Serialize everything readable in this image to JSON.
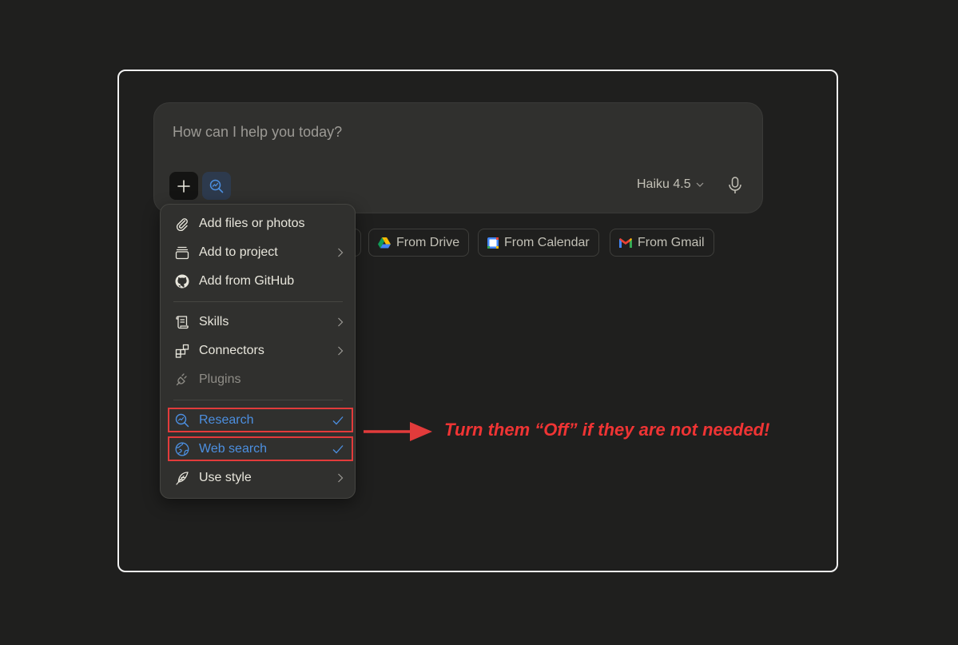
{
  "composer": {
    "placeholder": "How can I help you today?",
    "model": "Haiku 4.5"
  },
  "chips": [
    {
      "label": "From Drive",
      "icon": "google-drive-icon"
    },
    {
      "label": "From Calendar",
      "icon": "google-calendar-icon"
    },
    {
      "label": "From Gmail",
      "icon": "gmail-icon"
    }
  ],
  "menu": {
    "items": [
      {
        "label": "Add files or photos",
        "icon": "paperclip-icon",
        "submenu": false
      },
      {
        "label": "Add to project",
        "icon": "archive-box-icon",
        "submenu": true
      },
      {
        "label": "Add from GitHub",
        "icon": "github-icon",
        "submenu": false
      },
      {
        "label": "Skills",
        "icon": "scroll-icon",
        "submenu": true
      },
      {
        "label": "Connectors",
        "icon": "blocks-icon",
        "submenu": true
      },
      {
        "label": "Plugins",
        "icon": "plug-icon",
        "submenu": false,
        "disabled": true
      },
      {
        "label": "Research",
        "icon": "research-icon",
        "checked": true
      },
      {
        "label": "Web search",
        "icon": "globe-icon",
        "checked": true
      },
      {
        "label": "Use style",
        "icon": "feather-icon",
        "submenu": true
      }
    ]
  },
  "annotation": {
    "text": "Turn them “Off” if they are not needed!",
    "color": "#ef3434"
  },
  "colors": {
    "background": "#1f1f1e",
    "panel": "#30302e",
    "accent": "#4c8fe0",
    "highlight": "#e23b3b"
  }
}
